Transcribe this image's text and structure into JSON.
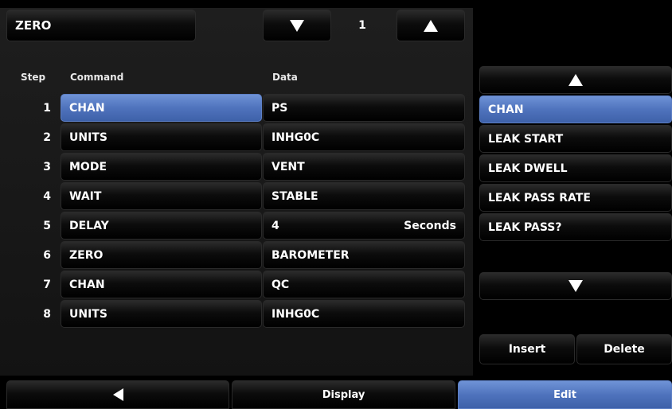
{
  "header": {
    "program_name": "ZERO",
    "page_number": "1"
  },
  "table": {
    "headers": {
      "step": "Step",
      "command": "Command",
      "data": "Data"
    },
    "rows": [
      {
        "step": "1",
        "command": "CHAN",
        "data": "PS",
        "suffix": "",
        "selected": true
      },
      {
        "step": "2",
        "command": "UNITS",
        "data": "INHG0C",
        "suffix": ""
      },
      {
        "step": "3",
        "command": "MODE",
        "data": "VENT",
        "suffix": ""
      },
      {
        "step": "4",
        "command": "WAIT",
        "data": "STABLE",
        "suffix": ""
      },
      {
        "step": "5",
        "command": "DELAY",
        "data": "4",
        "suffix": "Seconds"
      },
      {
        "step": "6",
        "command": "ZERO",
        "data": "BAROMETER",
        "suffix": ""
      },
      {
        "step": "7",
        "command": "CHAN",
        "data": "QC",
        "suffix": ""
      },
      {
        "step": "8",
        "command": "UNITS",
        "data": "INHG0C",
        "suffix": ""
      }
    ]
  },
  "command_list": {
    "items": [
      {
        "label": "CHAN",
        "selected": true
      },
      {
        "label": "LEAK START"
      },
      {
        "label": "LEAK DWELL"
      },
      {
        "label": "LEAK PASS RATE"
      },
      {
        "label": "LEAK PASS?"
      }
    ]
  },
  "actions": {
    "insert": "Insert",
    "delete": "Delete"
  },
  "bottom_bar": {
    "display": "Display",
    "edit": "Edit"
  },
  "colors": {
    "selected": "#4f73bd",
    "background": "#000000"
  },
  "icons": {
    "page_down": "triangle-down-icon",
    "page_up": "triangle-up-icon",
    "back": "triangle-left-icon"
  }
}
